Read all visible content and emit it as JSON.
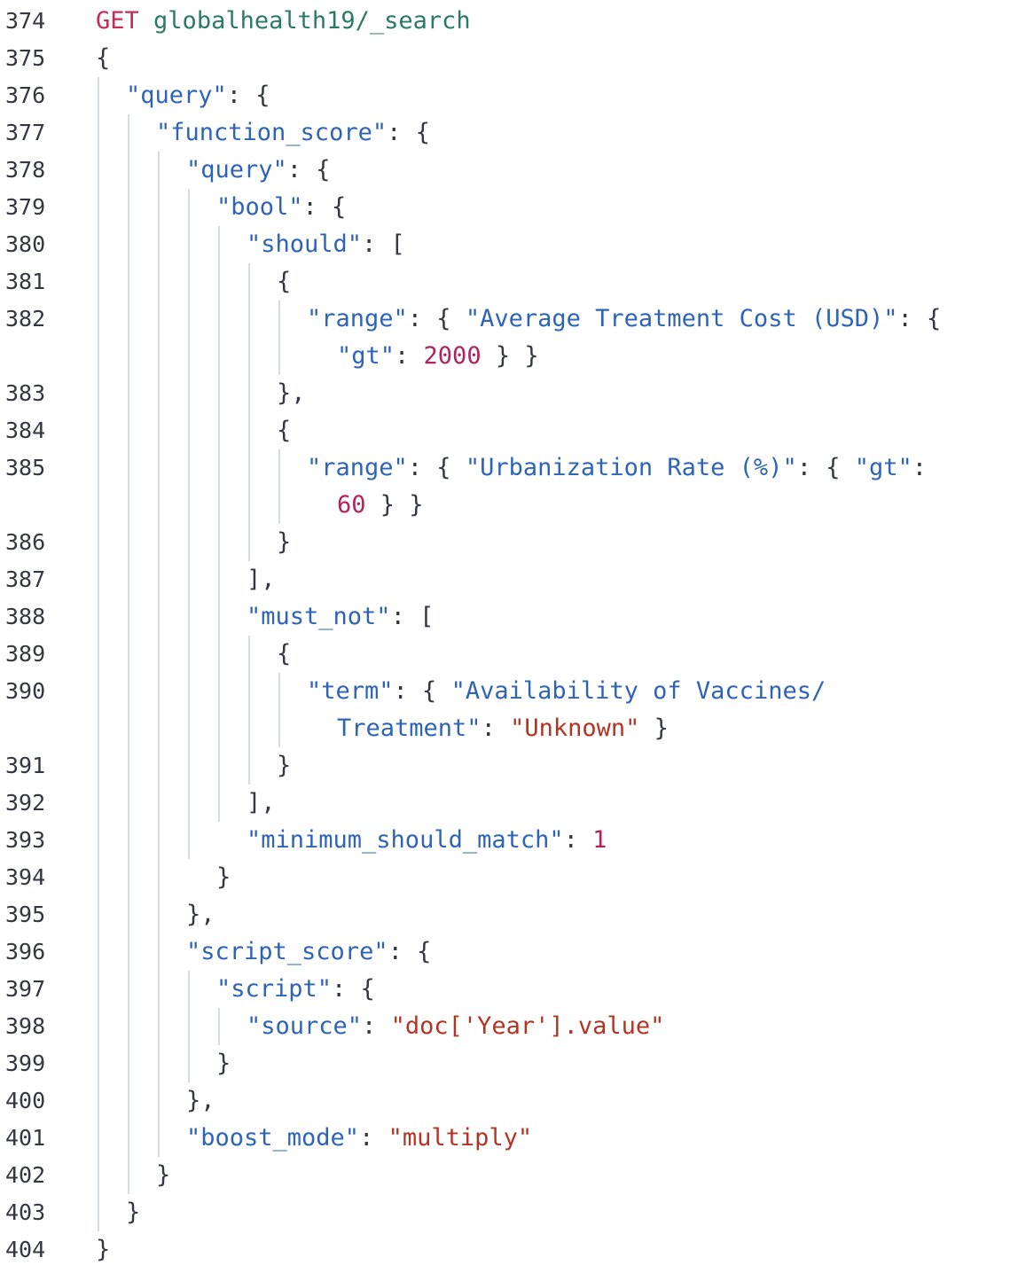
{
  "console": {
    "request": {
      "method": "GET",
      "path": "globalhealth19/_search"
    },
    "colors": {
      "method": "#c42d55",
      "path": "#2b7a63",
      "key": "#2d64b8",
      "string": "#b33423",
      "number": "#b0245d",
      "punctuation": "#343741",
      "indent_guide": "#d7dbe3"
    },
    "lines": [
      {
        "n": "374",
        "tokens": [
          [
            "m",
            "GET"
          ],
          [
            "p",
            " "
          ],
          [
            "path",
            "globalhealth19/_search"
          ]
        ]
      },
      {
        "n": "375",
        "tokens": [
          [
            "p",
            "{"
          ]
        ]
      },
      {
        "n": "376",
        "tokens": [
          [
            "k",
            "\"query\""
          ],
          [
            "p",
            ": {"
          ]
        ]
      },
      {
        "n": "377",
        "tokens": [
          [
            "k",
            "\"function_score\""
          ],
          [
            "p",
            ": {"
          ]
        ]
      },
      {
        "n": "378",
        "tokens": [
          [
            "k",
            "\"query\""
          ],
          [
            "p",
            ": {"
          ]
        ]
      },
      {
        "n": "379",
        "tokens": [
          [
            "k",
            "\"bool\""
          ],
          [
            "p",
            ": {"
          ]
        ]
      },
      {
        "n": "380",
        "tokens": [
          [
            "k",
            "\"should\""
          ],
          [
            "p",
            ": ["
          ]
        ]
      },
      {
        "n": "381",
        "tokens": [
          [
            "p",
            "{"
          ]
        ]
      },
      {
        "n": "382",
        "tokens": [
          [
            "k",
            "\"range\""
          ],
          [
            "p",
            ": { "
          ],
          [
            "k",
            "\"Average Treatment Cost (USD)\""
          ],
          [
            "p",
            ": {"
          ]
        ]
      },
      {
        "n": "",
        "tokens": [
          [
            "k",
            "\"gt\""
          ],
          [
            "p",
            ": "
          ],
          [
            "num",
            "2000"
          ],
          [
            "p",
            " } }"
          ]
        ]
      },
      {
        "n": "383",
        "tokens": [
          [
            "p",
            "},"
          ]
        ]
      },
      {
        "n": "384",
        "tokens": [
          [
            "p",
            "{"
          ]
        ]
      },
      {
        "n": "385",
        "tokens": [
          [
            "k",
            "\"range\""
          ],
          [
            "p",
            ": { "
          ],
          [
            "k",
            "\"Urbanization Rate (%)\""
          ],
          [
            "p",
            ": { "
          ],
          [
            "k",
            "\"gt\""
          ],
          [
            "p",
            ":"
          ]
        ]
      },
      {
        "n": "",
        "tokens": [
          [
            "num",
            "60"
          ],
          [
            "p",
            " } }"
          ]
        ]
      },
      {
        "n": "386",
        "tokens": [
          [
            "p",
            "}"
          ]
        ]
      },
      {
        "n": "387",
        "tokens": [
          [
            "p",
            "],"
          ]
        ]
      },
      {
        "n": "388",
        "tokens": [
          [
            "k",
            "\"must_not\""
          ],
          [
            "p",
            ": ["
          ]
        ]
      },
      {
        "n": "389",
        "tokens": [
          [
            "p",
            "{"
          ]
        ]
      },
      {
        "n": "390",
        "tokens": [
          [
            "k",
            "\"term\""
          ],
          [
            "p",
            ": { "
          ],
          [
            "k",
            "\"Availability of Vaccines/"
          ]
        ]
      },
      {
        "n": "",
        "tokens": [
          [
            "k",
            "Treatment\""
          ],
          [
            "p",
            ": "
          ],
          [
            "s",
            "\"Unknown\""
          ],
          [
            "p",
            " }"
          ]
        ]
      },
      {
        "n": "391",
        "tokens": [
          [
            "p",
            "}"
          ]
        ]
      },
      {
        "n": "392",
        "tokens": [
          [
            "p",
            "],"
          ]
        ]
      },
      {
        "n": "393",
        "tokens": [
          [
            "k",
            "\"minimum_should_match\""
          ],
          [
            "p",
            ": "
          ],
          [
            "num",
            "1"
          ]
        ]
      },
      {
        "n": "394",
        "tokens": [
          [
            "p",
            "}"
          ]
        ]
      },
      {
        "n": "395",
        "tokens": [
          [
            "p",
            "},"
          ]
        ]
      },
      {
        "n": "396",
        "tokens": [
          [
            "k",
            "\"script_score\""
          ],
          [
            "p",
            ": {"
          ]
        ]
      },
      {
        "n": "397",
        "tokens": [
          [
            "k",
            "\"script\""
          ],
          [
            "p",
            ": {"
          ]
        ]
      },
      {
        "n": "398",
        "tokens": [
          [
            "k",
            "\"source\""
          ],
          [
            "p",
            ": "
          ],
          [
            "s",
            "\"doc['Year'].value\""
          ]
        ]
      },
      {
        "n": "399",
        "tokens": [
          [
            "p",
            "}"
          ]
        ]
      },
      {
        "n": "400",
        "tokens": [
          [
            "p",
            "},"
          ]
        ]
      },
      {
        "n": "401",
        "tokens": [
          [
            "k",
            "\"boost_mode\""
          ],
          [
            "p",
            ": "
          ],
          [
            "s",
            "\"multiply\""
          ]
        ]
      },
      {
        "n": "402",
        "tokens": [
          [
            "p",
            "}"
          ]
        ]
      },
      {
        "n": "403",
        "tokens": [
          [
            "p",
            "}"
          ]
        ]
      },
      {
        "n": "404",
        "tokens": [
          [
            "p",
            "}"
          ]
        ]
      }
    ]
  }
}
